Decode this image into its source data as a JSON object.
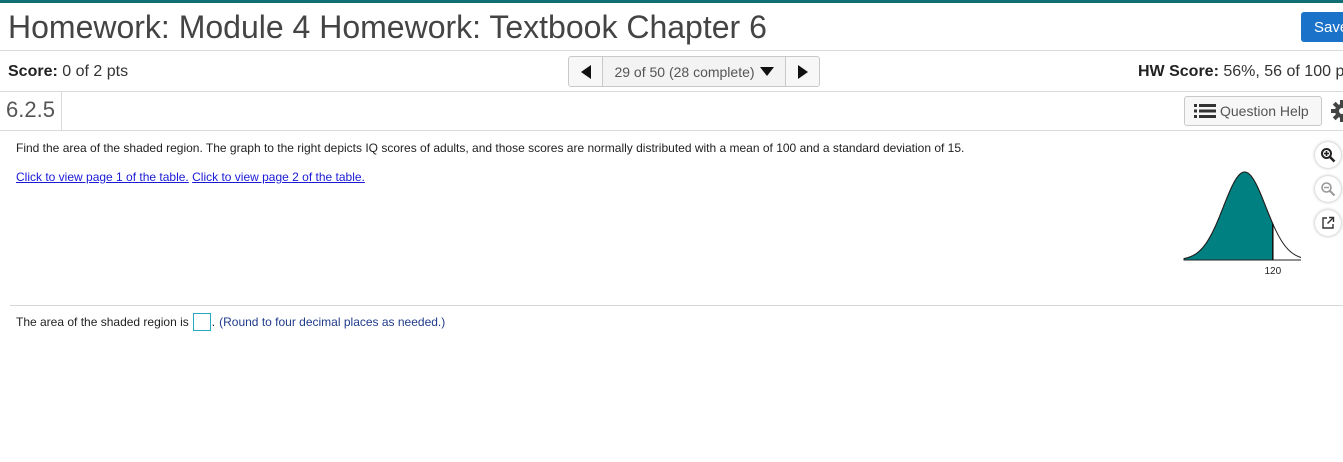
{
  "header": {
    "title": "Homework: Module 4 Homework: Textbook Chapter 6",
    "save_label": "Save"
  },
  "score_bar": {
    "score_label": "Score:",
    "score_value": "0 of 2 pts",
    "nav_label": "29 of 50 (28 complete)",
    "hw_score_label": "HW Score:",
    "hw_score_value": "56%, 56 of 100 p"
  },
  "question_bar": {
    "number": "6.2.5",
    "help_label": "Question Help"
  },
  "question": {
    "prompt": "Find the area of the shaded region. The graph to the right depicts IQ scores of adults, and those scores are normally distributed with a mean of 100 and a standard deviation of 15.",
    "link_page1": "Click to view page 1 of the table.",
    "link_page2": "Click to view page 2 of the table.",
    "graph_tick_label": "120",
    "answer_prefix": "The area of the shaded region is",
    "answer_value": "",
    "answer_suffix_punct": ".",
    "answer_hint": "(Round to four decimal places as needed.)"
  },
  "colors": {
    "accent": "#0f6f73",
    "save_button": "#1a73c8",
    "shaded_region": "#008080",
    "link": "#1a1ad6"
  },
  "icons": [
    "chevron-left-icon",
    "chevron-right-icon",
    "caret-down-icon",
    "list-icon",
    "gear-icon",
    "zoom-in-icon",
    "zoom-out-icon",
    "external-link-icon"
  ]
}
